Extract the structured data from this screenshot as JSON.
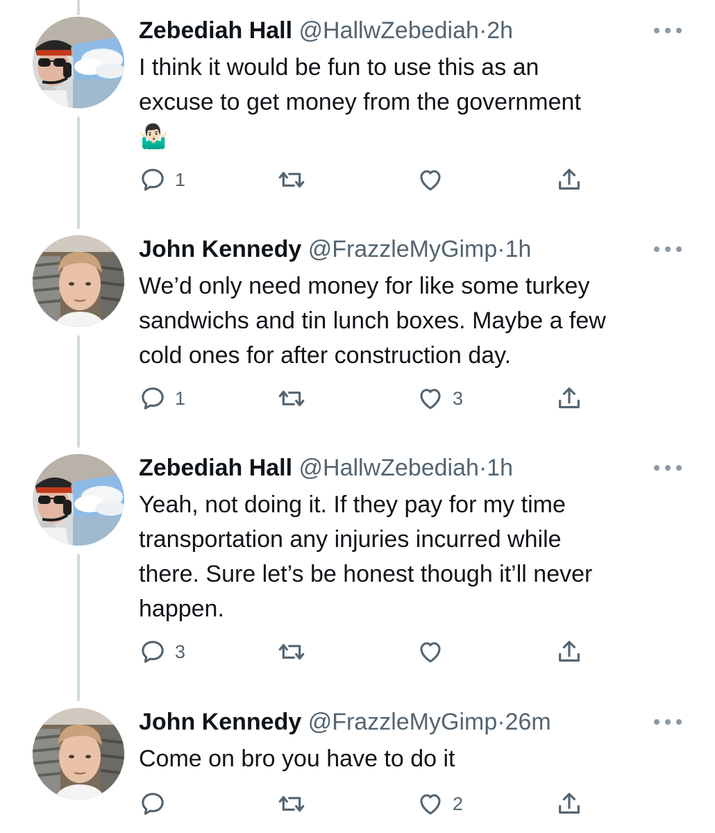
{
  "tweets": [
    {
      "name": "Zebediah Hall",
      "handle": "@HallwZebediah",
      "separator": "·",
      "time": "2h",
      "lines": [
        "I think it would be fun to use this as an",
        "excuse to get money from the government"
      ],
      "emoji": "🤷🏻‍♂️",
      "reply_count": "1",
      "retweet_count": "",
      "like_count": ""
    },
    {
      "name": "John Kennedy",
      "handle": "@FrazzleMyGimp",
      "separator": "·",
      "time": "1h",
      "lines": [
        "We’d only need money for like some turkey",
        "sandwichs and tin lunch boxes. Maybe a few",
        "cold ones for after construction day."
      ],
      "reply_count": "1",
      "retweet_count": "",
      "like_count": "3"
    },
    {
      "name": "Zebediah Hall",
      "handle": "@HallwZebediah",
      "separator": "·",
      "time": "1h",
      "lines": [
        "Yeah, not doing it. If they pay for my time",
        "transportation any injuries incurred while",
        "there. Sure let’s be honest though it’ll never",
        "happen."
      ],
      "reply_count": "3",
      "retweet_count": "",
      "like_count": ""
    },
    {
      "name": "John Kennedy",
      "handle": "@FrazzleMyGimp",
      "separator": "·",
      "time": "26m",
      "lines": [
        "Come on bro you have to do it"
      ],
      "reply_count": "",
      "retweet_count": "",
      "like_count": "2"
    }
  ],
  "icons": {
    "reply": "reply-icon",
    "retweet": "retweet-icon",
    "like": "heart-icon",
    "share": "share-icon",
    "more": "more-icon"
  },
  "colors": {
    "text": "#0f1419",
    "muted": "#536471",
    "thread_line": "#cfd9de"
  }
}
